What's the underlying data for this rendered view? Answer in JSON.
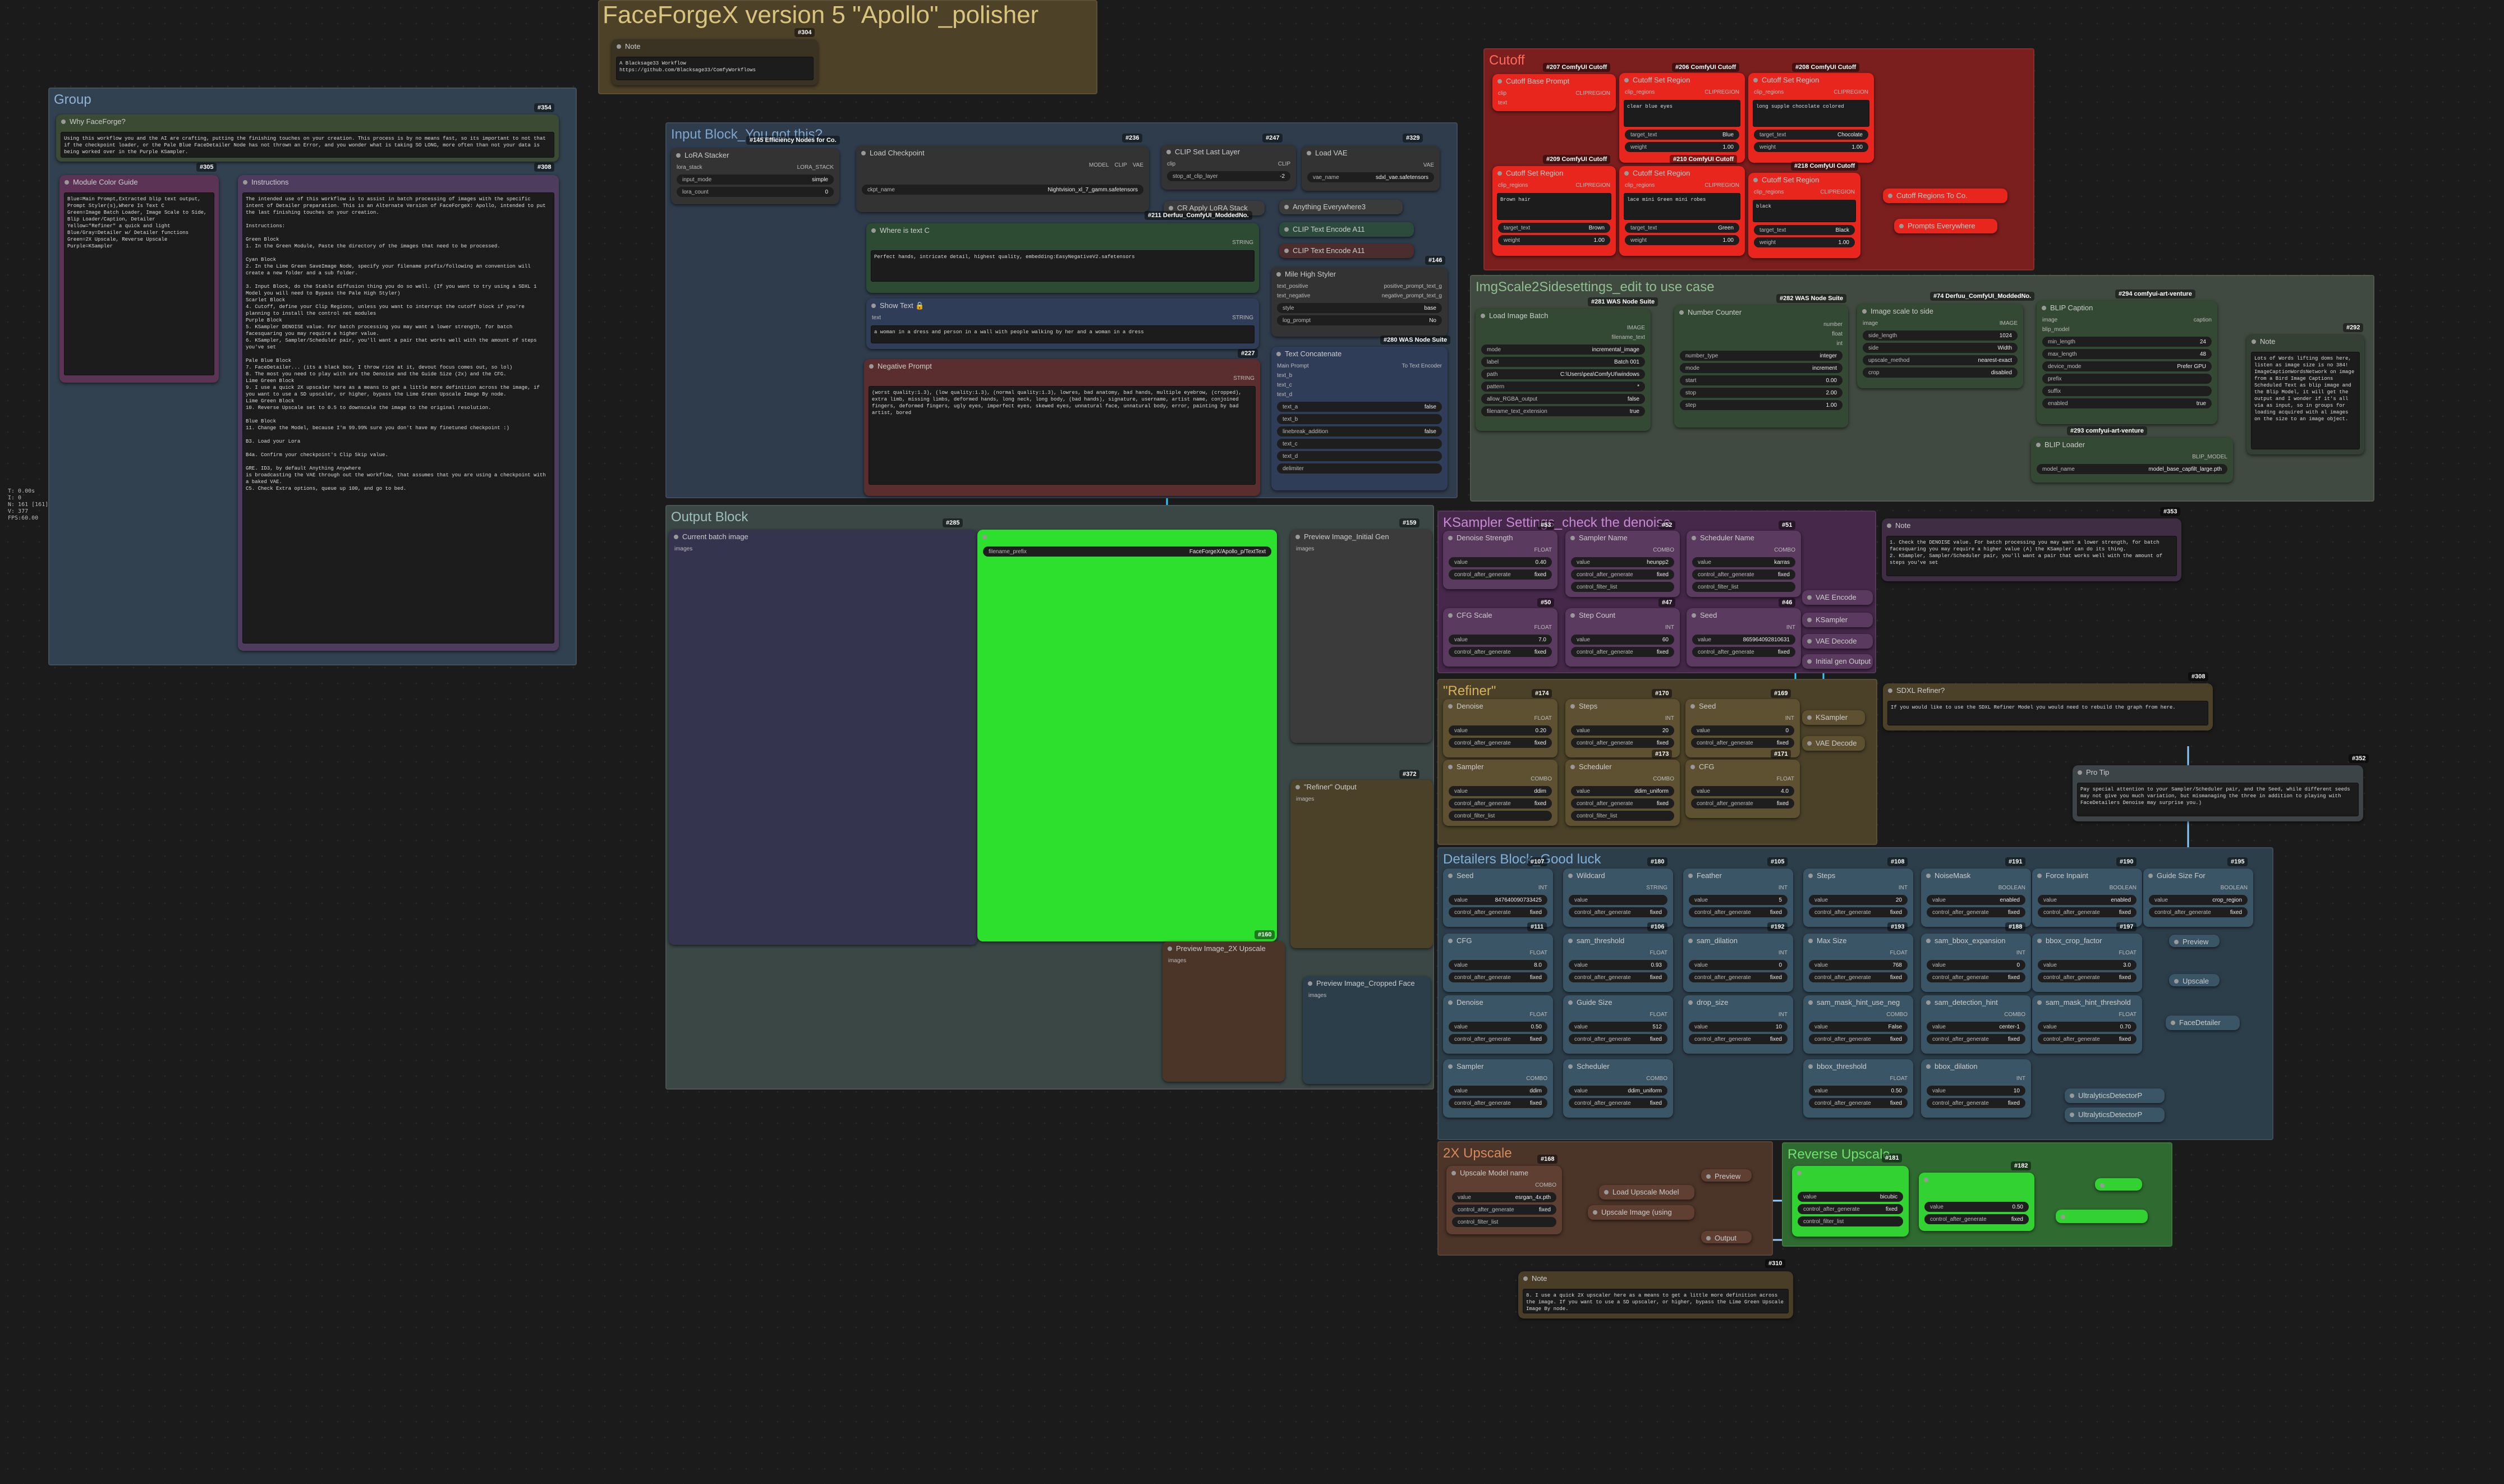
{
  "app": {
    "stats": [
      "T: 0.00s",
      "I: 0",
      "N: 161 [161]",
      "V: 377",
      "FPS:60.00"
    ]
  },
  "groups": {
    "title": "FaceForgeX version 5 \"Apollo\"_polisher",
    "group": "Group",
    "input": "Input Block_You got this?",
    "cutoff": "Cutoff",
    "imgscale": "ImgScale2Sidesettings_edit to use case",
    "output": "Output Block",
    "ksampler": "KSampler Settings_check the denoise",
    "refiner": "\"Refiner\"",
    "detailers": "Detailers Block_Good luck",
    "upscale2x": "2X Upscale",
    "reverse": "Reverse Upscale"
  },
  "nodes": {
    "note_top": {
      "title": "Note",
      "badge": "#304",
      "text": "A Blacksage33 Workflow https://github.com/Blacksage33/ComfyWorkflows"
    },
    "why": {
      "title": "Why FaceForge?",
      "badge": "#354",
      "text": "Using this workflow you and the AI are crafting, putting the finishing touches on your creation. This process is by no means fast, so its important to not that if the checkpoint loader, or the Pale Blue FaceDetailer Node has not thrown an Error, and you wonder what is taking SO LONG, more often than not your data is being worked over in the Purple KSampler."
    },
    "color": {
      "title": "Module Color Guide",
      "badge": "#305",
      "text": "Blue=Main Prompt,Extracted blip text output, Prompt Styler(s),Where Is Text C\nGreen=Image Batch Loader, Image Scale to Side, Blip Loader/Caption, Detailer\nYellow=\"Refiner\" a quick and light\nBlue/Gray=Detailer w/ Detailer functions\nGreen=2X Upscale, Reverse Upscale\nPurple=KSampler"
    },
    "instr": {
      "title": "Instructions",
      "badge": "#308",
      "text": "The intended use of this workflow is to assist in batch processing of images with the specific intent of Detailer preparation. This is an Alternate Version of FaceForgeX: Apollo, intended to put the last finishing touches on your creation.\n\nInstructions:\n\nGreen Block\n1. In the Green Module, Paste the directory of the images that need to be processed.\n\nCyan Block\n2. In the Lime Green SaveImage Node, specify your filename prefix/following an convention will create a new folder and a sub folder.\n\n3. Input Block, do the Stable diffusion thing you do so well. (If you want to try using a SDXL 1 Model you will need to Bypass the Pale High Styler)\nScarlet Block\n4. Cutoff, define your Clip Regions, unless you want to interrupt the cutoff block if you're planning to install the control net modules\nPurple Block\n5. KSampler DENOISE value. For batch processing you may want a lower strength, for batch facesquaring you may require a higher value.\n6. KSampler, Sampler/Scheduler pair, you'll want a pair that works well with the amount of steps you've set\n\nPale Blue Block\n7. FaceDetailer... (its a black box, I throw rice at it, devout focus comes out, so lol)\n8. The most you need to play with are the Denoise and the Guide Size (2x) and the CFG.\nLime Green Block\n9. I use a quick 2X upscaler here as a means to get a little more definition across the image, if you want to use a SD upscaler, or higher, bypass the Lime Green Upscale Image By node.\nLime Green Block\n10. Reverse Upscale set to 0.5 to downscale the image to the original resolution.\n\nBlue Block\n11. Change the Model, because I'm 99.99% sure you don't have my finetuned checkpoint :)\n\nB3. Load your Lora\n\nB4a. Confirm your checkpoint's Clip Skip value.\n\nGRE. ID3, by default Anything Anywhere\nis broadcasting the VAE through out the workflow, that assumes that you are using a checkpoint with a baked VAE.\nC5. Check Extra options, queue up 100, and go to bed."
    },
    "lora": {
      "title": "LoRA Stacker",
      "badge": "#145 Efficiency Nodes for Co.",
      "port_in": "lora_stack",
      "port_out": "LORA_STACK",
      "w1k": "input_mode",
      "w1v": "simple",
      "w2k": "lora_count",
      "w2v": "0"
    },
    "ckpt": {
      "title": "Load Checkpoint",
      "badge": "#236",
      "ports_out": [
        "MODEL",
        "CLIP",
        "VAE"
      ],
      "wk": "ckpt_name",
      "wv": "Nightvision_xl_7_gamm.safetensors"
    },
    "cliplast": {
      "title": "CLIP Set Last Layer",
      "badge": "#247",
      "p_in": "clip",
      "p_out": "CLIP",
      "wk": "stop_at_clip_layer",
      "wv": "-2"
    },
    "vae": {
      "title": "Load VAE",
      "badge": "#329",
      "p_out": "VAE",
      "wk": "vae_name",
      "wv": "sdxl_vae.safetensors"
    },
    "cr_lora": {
      "title": "CR Apply LoRA Stack",
      "sub": "#211 Derfuu_ComfyUI_ModdedNo."
    },
    "anywhere": {
      "title": "Anything Everywhere3"
    },
    "enc1": {
      "title": "CLIP Text Encode A11"
    },
    "enc2": {
      "title": "CLIP Text Encode A11"
    },
    "where": {
      "title": "Where is text C",
      "p_out": "STRING",
      "text": "Perfect hands, intricate detail, highest quality, embedding:EasyNegativeV2.safetensors"
    },
    "styler": {
      "title": "Mile High Styler",
      "badge": "#146",
      "rows": [
        [
          "text_positive",
          "positive_prompt_text_g"
        ],
        [
          "text_negative",
          "negative_prompt_text_g"
        ],
        [
          "style",
          "base"
        ],
        [
          "log_prompt",
          "No"
        ]
      ]
    },
    "show": {
      "title": "Show Text",
      "p_in": "text",
      "p_out": "STRING",
      "text": "a woman in a dress and person in a wall with people walking by her and a woman in a dress",
      "badge": "#280 WAS Node Suite"
    },
    "concat": {
      "title": "Text Concatenate",
      "badge": "#227",
      "rows": [
        [
          "Main Prompt",
          "To Text Encoder"
        ],
        [
          "text_b",
          ""
        ],
        [
          "text_c",
          ""
        ],
        [
          "text_d",
          ""
        ]
      ],
      "w": [
        [
          "text_a",
          "false"
        ],
        [
          "text_b",
          ""
        ],
        [
          "linebreak_addition",
          "false"
        ],
        [
          "text_c",
          ""
        ],
        [
          "text_d",
          ""
        ],
        [
          "delimiter",
          ""
        ]
      ]
    },
    "neg": {
      "title": "Negative Prompt",
      "p_out": "STRING",
      "text": "(worst quality:1.3), (low quality:1.3), (normal quality:1.3), lowres, bad anatomy, bad hands, multiple eyebrow, (cropped), extra limb, missing limbs, deformed hands, long neck, long body, (bad hands), signature, username, artist name, conjoined fingers, deformed fingers, ugly eyes, imperfect eyes, skewed eyes, unnatural face, unnatural body, error, painting by bad artist, bored"
    },
    "cut1": {
      "title": "Cutoff Base Prompt",
      "badge": "#207 ComfyUI Cutoff",
      "rows": [
        [
          "clip",
          "CLIPREGION"
        ],
        [
          "text",
          ""
        ]
      ]
    },
    "cut2": {
      "title": "Cutoff Set Region",
      "badge": "#206 ComfyUI Cutoff",
      "text": "clear blue eyes",
      "tw": "Blue",
      "wt": "1.00"
    },
    "cut3": {
      "title": "Cutoff Set Region",
      "badge": "#208 ComfyUI Cutoff",
      "text": "long supple chocolate colored",
      "tw": "Chocolate",
      "wt": "1.00"
    },
    "cut4": {
      "title": "Cutoff Set Region",
      "badge": "#209 ComfyUI Cutoff",
      "text": "Brown hair",
      "tw": "Brown",
      "wt": "1.00"
    },
    "cut5": {
      "title": "Cutoff Set Region",
      "badge": "#210 ComfyUI Cutoff",
      "text": "lace mini Green mini robes",
      "tw": "Green",
      "wt": "1.00"
    },
    "cut6": {
      "title": "Cutoff Set Region",
      "badge": "#218 ComfyUI Cutoff",
      "text": "black",
      "tw": "Black",
      "wt": "1.00"
    },
    "cut_regions": {
      "title": "Cutoff Regions To Co."
    },
    "prompts_every": {
      "title": "Prompts Everywhere"
    },
    "batch": {
      "title": "Load Image Batch",
      "badge": "#281 WAS Node Suite",
      "rows": [
        [
          "image",
          "IMAGE"
        ],
        [
          "",
          "filename_text"
        ]
      ],
      "w": [
        [
          "mode",
          "incremental_image"
        ],
        [
          "label",
          "Batch 001"
        ],
        [
          "path",
          "C:\\Users\\pea\\ComfyUI\\windows"
        ],
        [
          "pattern",
          "*"
        ],
        [
          "allow_RGBA_output",
          "false"
        ],
        [
          "filename_text_extension",
          "true"
        ]
      ]
    },
    "counter": {
      "title": "Number Counter",
      "badge": "#282 WAS Node Suite",
      "w": [
        [
          "number_type",
          "integer"
        ],
        [
          "mode",
          "increment"
        ],
        [
          "start",
          "0.00"
        ],
        [
          "stop",
          "2.00"
        ],
        [
          "step",
          "1.00"
        ]
      ],
      "outs": [
        "number",
        "float",
        "int"
      ]
    },
    "scale": {
      "title": "Image scale to side",
      "badge": "#74 Derfuu_ComfyUI_ModdedNo.",
      "p_in": "image",
      "p_out": "IMAGE",
      "w": [
        [
          "side_length",
          "1024"
        ],
        [
          "side",
          "Width"
        ],
        [
          "upscale_method",
          "nearest-exact"
        ],
        [
          "crop",
          "disabled"
        ]
      ]
    },
    "blip": {
      "title": "BLIP Caption",
      "badge": "#294 comfyui-art-venture",
      "rows": [
        [
          "image",
          "caption"
        ],
        [
          "blip_model",
          ""
        ]
      ],
      "w": [
        [
          "min_length",
          "24"
        ],
        [
          "max_length",
          "48"
        ],
        [
          "device_mode",
          "Prefer GPU"
        ],
        [
          "prefix",
          ""
        ],
        [
          "suffix",
          ""
        ],
        [
          "enabled",
          "true"
        ]
      ]
    },
    "blip_loader": {
      "title": "BLIP Loader",
      "badge": "#293 comfyui-art-venture",
      "p_out": "BLIP_MODEL",
      "wk": "model_name",
      "wv": "model_base_capfilt_large.pth"
    },
    "note_blip": {
      "title": "Note",
      "badge": "#292",
      "text": "Lots of Words lifting doms here, listen as image size is no 384! ImageCaptionWordsNetwork on image from a Bird Image Captions Scheduled Text as blip image and the Blip Model, it will get the output and I wonder if it's all via as input, so in groups for loading acquired with al images on the size to an image object."
    },
    "cur_batch": {
      "title": "Current batch image",
      "p": "images"
    },
    "save": {
      "title": "Save Image",
      "badge": "#285",
      "w": [
        "filename_prefix",
        "FaceForgeX/Apollo_p/TextText"
      ]
    },
    "preview_init": {
      "title": "Preview Image_Initial Gen",
      "badge": "#159",
      "p": "images"
    },
    "refiner_out": {
      "title": "\"Refiner\" Output",
      "badge": "#372",
      "p": "images"
    },
    "preview_2x": {
      "title": "Preview Image_2X Upscale",
      "badge": "#160",
      "p": "images"
    },
    "preview_face": {
      "title": "Preview Image_Cropped Face",
      "p": "images"
    },
    "ks": {
      "denoise": {
        "title": "Denoise Strength",
        "badge": "#53",
        "t": "FLOAT",
        "v": "0.40"
      },
      "sampler": {
        "title": "Sampler Name",
        "badge": "#52",
        "t": "COMBO",
        "v": "heunpp2"
      },
      "sched": {
        "title": "Scheduler Name",
        "badge": "#51",
        "t": "COMBO",
        "v": "karras"
      },
      "cfg": {
        "title": "CFG Scale",
        "badge": "#50",
        "t": "FLOAT",
        "v": "7.0"
      },
      "steps": {
        "title": "Step Count",
        "badge": "#47",
        "t": "INT",
        "v": "60"
      },
      "seed": {
        "title": "Seed",
        "badge": "#46",
        "t": "INT",
        "v": "865964092810631"
      },
      "vae_enc": "VAE Encode",
      "ksampler": "KSampler",
      "vae_dec": "VAE Decode",
      "initial": "Initial gen Output"
    },
    "note_ks": {
      "title": "Note",
      "badge": "#353",
      "text": "1. Check the DENOISE value. For batch processing you may want a lower strength, for batch facesquaring you may require a higher value (A) the KSampler can do its thing.\n2. KSampler, Sampler/Scheduler pair, you'll want a pair that works well with the amount of steps you've set"
    },
    "rf": {
      "denoise": {
        "title": "Denoise",
        "badge": "#174",
        "t": "FLOAT",
        "v": "0.20"
      },
      "steps": {
        "title": "Steps",
        "badge": "#170",
        "t": "INT",
        "v": "20"
      },
      "seed": {
        "title": "Seed",
        "badge": "#169",
        "t": "INT",
        "v": "0"
      },
      "sampler": {
        "title": "Sampler",
        "t": "COMBO",
        "v": "ddim"
      },
      "sched": {
        "title": "Scheduler",
        "badge": "#173",
        "t": "COMBO",
        "v": "ddim_uniform"
      },
      "cfg": {
        "title": "CFG",
        "badge": "#171",
        "t": "FLOAT",
        "v": "4.0"
      },
      "ks": "KSampler",
      "vd": "VAE Decode"
    },
    "sdxl": {
      "title": "SDXL Refiner?",
      "badge": "#308",
      "text": "If you would like to use the SDXL Refiner Model you would need to rebuild the graph from here."
    },
    "protip": {
      "title": "Pro Tip",
      "badge": "#352",
      "text": "Pay special attention to your Sampler/Scheduler pair, and the Seed, while different seeds may not give you much variation, but mismanaging the three in addition to playing with FaceDetailers Denoise may surprise you.)"
    },
    "dt": [
      {
        "title": "Seed",
        "badge": "#107",
        "t": "INT",
        "v": "847640090733425"
      },
      {
        "title": "Wildcard",
        "badge": "#180",
        "t": "STRING",
        "v": ""
      },
      {
        "title": "Feather",
        "badge": "#105",
        "t": "INT",
        "v": "5"
      },
      {
        "title": "Steps",
        "badge": "#108",
        "t": "INT",
        "v": "20"
      },
      {
        "title": "NoiseMask",
        "badge": "#191",
        "t": "BOOLEAN",
        "v": "enabled"
      },
      {
        "title": "Force Inpaint",
        "badge": "#190",
        "t": "BOOLEAN",
        "v": "enabled"
      },
      {
        "title": "Guide Size For",
        "badge": "#195",
        "t": "BOOLEAN",
        "v": "crop_region"
      },
      {
        "title": "CFG",
        "badge": "#111",
        "t": "FLOAT",
        "v": "8.0"
      },
      {
        "title": "sam_threshold",
        "badge": "#106",
        "t": "FLOAT",
        "v": "0.93"
      },
      {
        "title": "sam_dilation",
        "badge": "#192",
        "t": "INT",
        "v": "0"
      },
      {
        "title": "Max Size",
        "badge": "#193",
        "t": "FLOAT",
        "v": "768"
      },
      {
        "title": "sam_bbox_expansion",
        "badge": "#188",
        "t": "INT",
        "v": "0"
      },
      {
        "title": "bbox_crop_factor",
        "badge": "#197",
        "t": "FLOAT",
        "v": "3.0"
      },
      {
        "title": "Denoise",
        "t": "FLOAT",
        "v": "0.50"
      },
      {
        "title": "Guide Size",
        "t": "FLOAT",
        "v": "512"
      },
      {
        "title": "drop_size",
        "t": "INT",
        "v": "10"
      },
      {
        "title": "sam_mask_hint_use_neg",
        "t": "COMBO",
        "v": "False"
      },
      {
        "title": "sam_detection_hint",
        "t": "COMBO",
        "v": "center-1"
      },
      {
        "title": "sam_mask_hint_threshold",
        "t": "FLOAT",
        "v": "0.70"
      },
      {
        "title": "Sampler",
        "t": "COMBO",
        "v": "ddim"
      },
      {
        "title": "Scheduler",
        "t": "COMBO",
        "v": "ddim_uniform"
      },
      {
        "title": "bbox_threshold",
        "t": "FLOAT",
        "v": "0.50"
      },
      {
        "title": "bbox_dilation",
        "t": "INT",
        "v": "10"
      }
    ],
    "dt_other": {
      "facedetailer": "FaceDetailer",
      "ultra1": "UltralyticsDetectorP",
      "ultra2": "UltralyticsDetectorP",
      "preview": "Preview",
      "upscale": "Upscale"
    },
    "up": {
      "title": "Upscale Model name",
      "badge": "#168",
      "t": "COMBO",
      "v": "esrgan_4x.pth",
      "load": "Load Upscale Model",
      "using": "Upscale Image (using",
      "preview": "Preview",
      "output": "Output"
    },
    "rev": {
      "badge1": "#181",
      "badge2": "#182",
      "v1": "bicubic",
      "v2": "0.50"
    },
    "note_bottom": {
      "title": "Note",
      "badge": "#310",
      "text": "8. I use a quick 2X upscaler here as a means to get a little more definition across the image. If you want to use a SD upscaler, or higher, bypass the Lime Green Upscale Image By node."
    }
  },
  "common": {
    "value": "value",
    "control": "control_after_generate",
    "fixed": "fixed",
    "filter": "control_filter_list",
    "target": "target_text",
    "weight": "weight",
    "clip_regions": "clip_regions",
    "clip": "clip",
    "clipregion": "CLIPREGION"
  }
}
